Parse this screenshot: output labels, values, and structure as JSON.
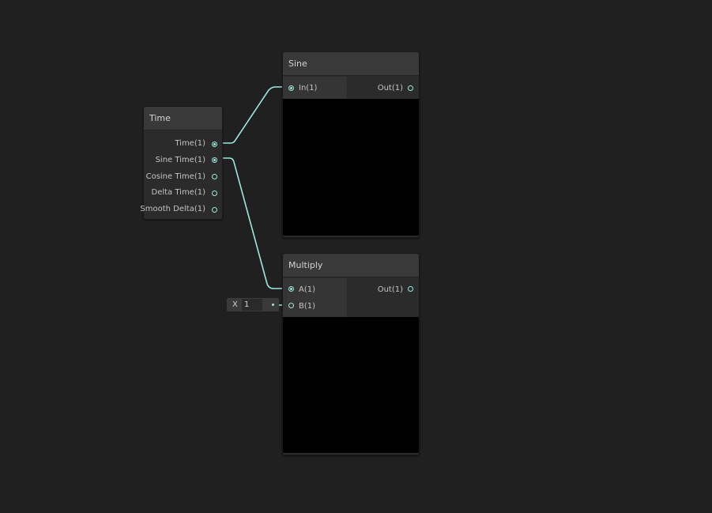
{
  "nodes": {
    "time": {
      "title": "Time",
      "outputs": [
        "Time(1)",
        "Sine Time(1)",
        "Cosine Time(1)",
        "Delta Time(1)",
        "Smooth Delta(1)"
      ]
    },
    "sine": {
      "title": "Sine",
      "input": "In(1)",
      "output": "Out(1)"
    },
    "multiply": {
      "title": "Multiply",
      "input_a": "A(1)",
      "input_b": "B(1)",
      "output": "Out(1)",
      "b_field_label": "X",
      "b_field_value": "1"
    }
  },
  "colors": {
    "background": "#202020",
    "node_body": "#2b2b2b",
    "node_header": "#393939",
    "preview": "#000000",
    "wire": "#9ce8de",
    "port": "#9ce8de"
  }
}
